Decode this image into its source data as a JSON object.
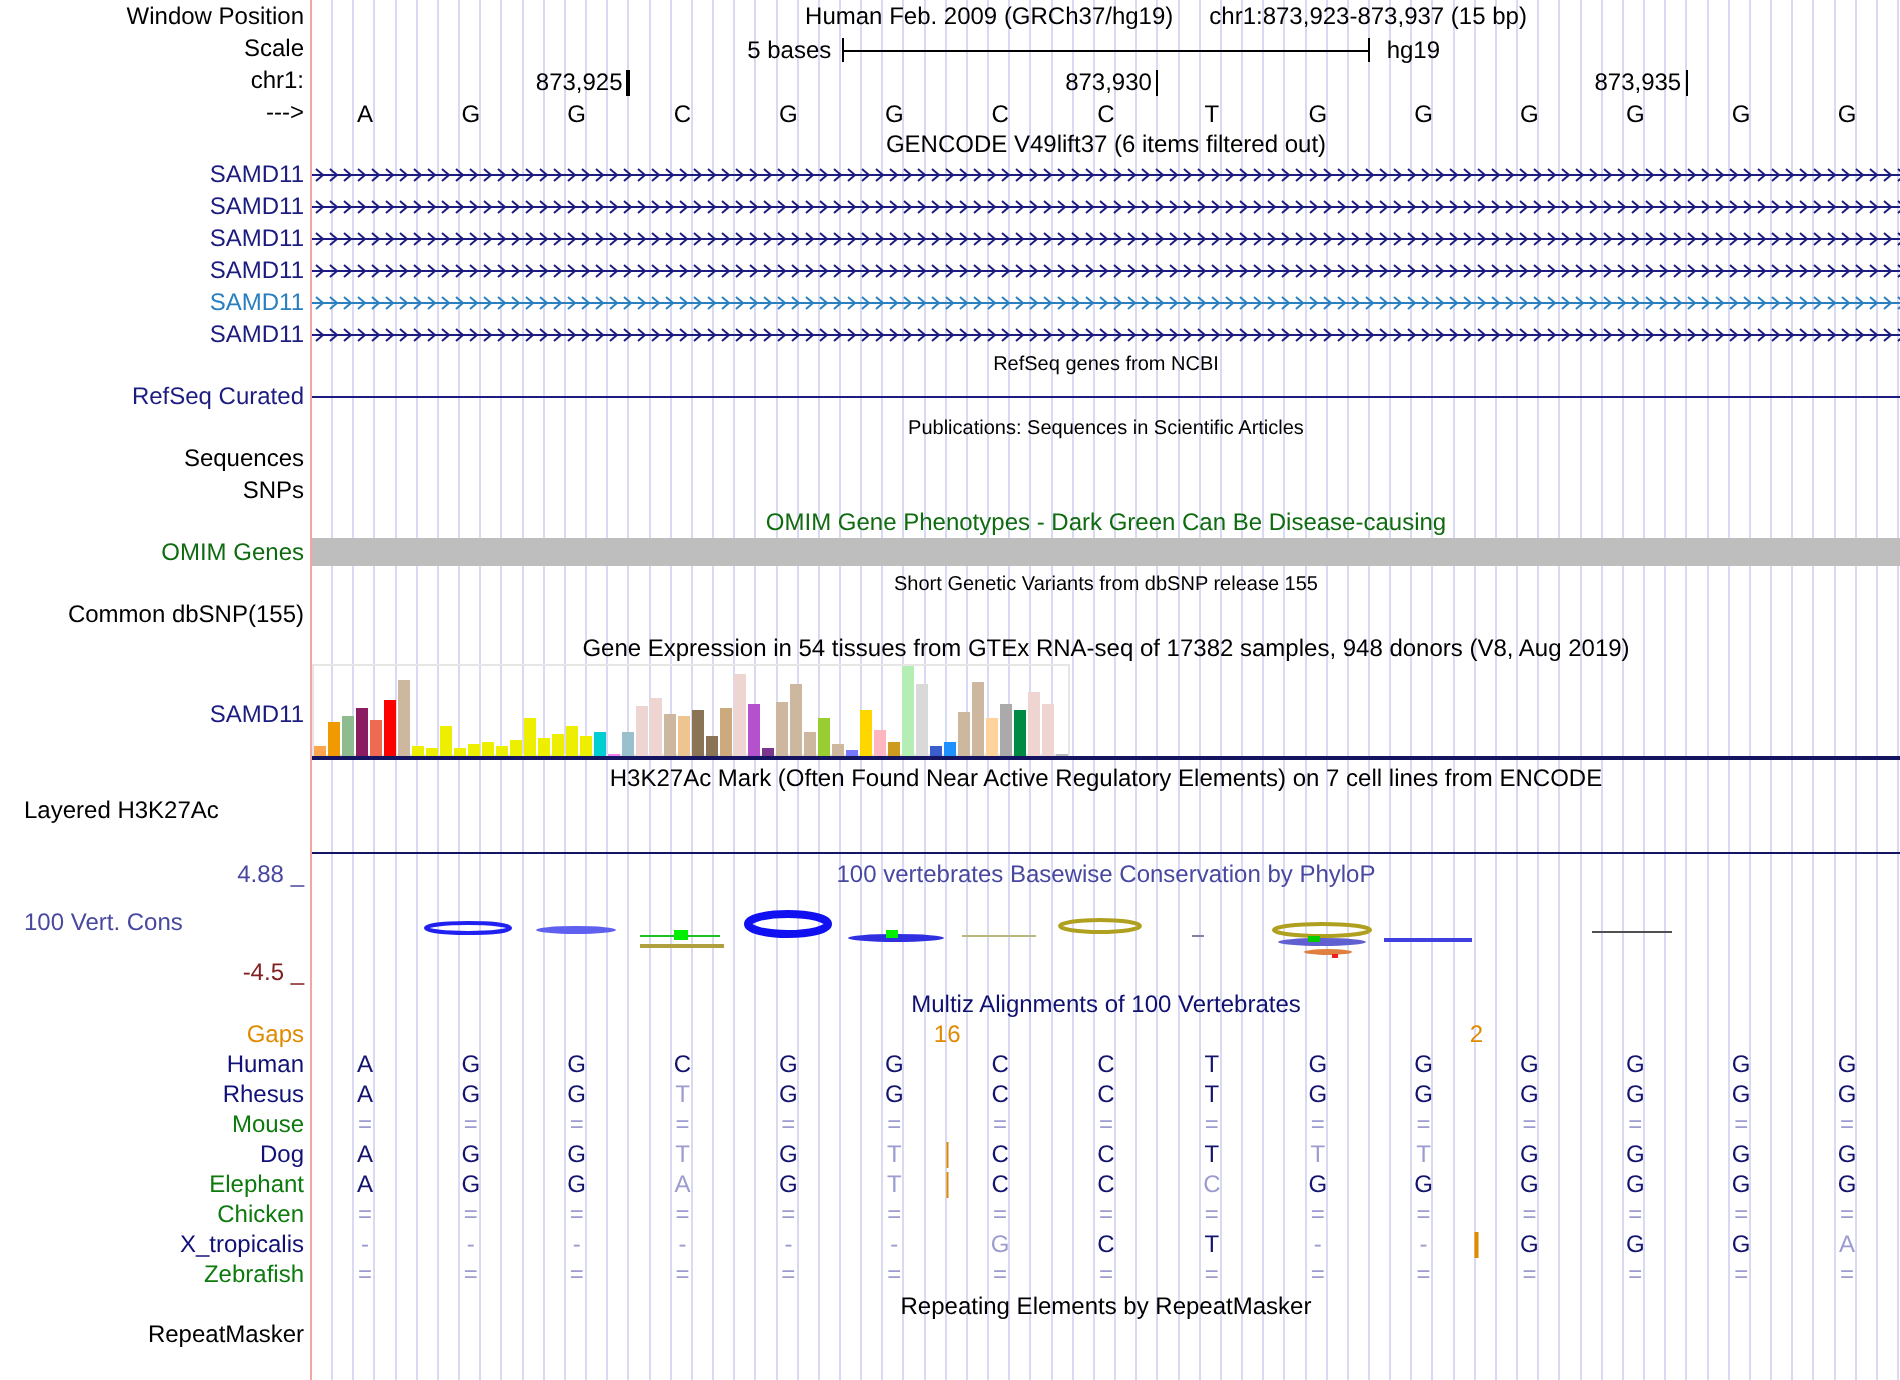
{
  "header": {
    "label": "Window Position",
    "assembly_title": "Human Feb. 2009 (GRCh37/hg19)",
    "position": "chr1:873,923-873,937 (15 bp)"
  },
  "scale": {
    "label": "Scale",
    "bar_label": "5 bases",
    "assembly": "hg19"
  },
  "ruler": {
    "label": "chr1:",
    "ticks": [
      "873,925",
      "873,930",
      "873,935"
    ]
  },
  "bases": {
    "label": "--->",
    "sequence": [
      "A",
      "G",
      "G",
      "C",
      "G",
      "G",
      "C",
      "C",
      "T",
      "G",
      "G",
      "G",
      "G",
      "G",
      "G"
    ]
  },
  "gencode": {
    "title": "GENCODE V49lift37 (6 items filtered out)",
    "transcripts": [
      {
        "label": "SAMD11",
        "color": "#1c1c80"
      },
      {
        "label": "SAMD11",
        "color": "#1c1c80"
      },
      {
        "label": "SAMD11",
        "color": "#1c1c80"
      },
      {
        "label": "SAMD11",
        "color": "#1c1c80"
      },
      {
        "label": "SAMD11",
        "color": "#2a7fc0"
      },
      {
        "label": "SAMD11",
        "color": "#1c1c80"
      }
    ]
  },
  "refseq": {
    "title": "RefSeq genes from NCBI",
    "label": "RefSeq Curated"
  },
  "publications": {
    "title": "Publications: Sequences in Scientific Articles",
    "labels": [
      "Sequences",
      "SNPs"
    ]
  },
  "omim": {
    "title": "OMIM Gene Phenotypes - Dark Green Can Be Disease-causing",
    "label": "OMIM Genes"
  },
  "dbsnp": {
    "title": "Short Genetic Variants from dbSNP release 155",
    "label": "Common dbSNP(155)"
  },
  "gtex": {
    "title": "Gene Expression in 54 tissues from GTEx RNA-seq of 17382 samples, 948 donors (V8, Aug 2019)",
    "label": "SAMD11"
  },
  "h3k27ac": {
    "title": "H3K27Ac Mark (Often Found Near Active Regulatory Elements) on 7 cell lines from ENCODE",
    "label": "Layered H3K27Ac"
  },
  "phylop": {
    "title": "100 vertebrates Basewise Conservation by PhyloP",
    "label": "100 Vert. Cons",
    "max": "4.88 _",
    "min": "-4.5 _"
  },
  "multiz": {
    "title": "Multiz Alignments of 100 Vertebrates",
    "gaps": {
      "label": "Gaps",
      "columns": [
        {
          "insert": false
        },
        {
          "insert": false
        },
        {
          "insert": false
        },
        {
          "insert": false
        },
        {
          "insert": false
        },
        {
          "insert": false
        },
        {
          "insert": true,
          "count": "16"
        },
        {
          "insert": false
        },
        {
          "insert": false
        },
        {
          "insert": false
        },
        {
          "insert": false
        },
        {
          "insert": true,
          "count": "2"
        },
        {
          "insert": false
        },
        {
          "insert": false
        },
        {
          "insert": false
        }
      ]
    },
    "species": [
      {
        "name": "Human",
        "color": "#101078",
        "cells": [
          {
            "base": "A",
            "faded": false,
            "insert": false
          },
          {
            "base": "G",
            "faded": false,
            "insert": false
          },
          {
            "base": "G",
            "faded": false,
            "insert": false
          },
          {
            "base": "C",
            "faded": false,
            "insert": false
          },
          {
            "base": "G",
            "faded": false,
            "insert": false
          },
          {
            "base": "G",
            "faded": false,
            "insert": false
          },
          {
            "base": "C",
            "faded": false,
            "insert": false
          },
          {
            "base": "C",
            "faded": false,
            "insert": false
          },
          {
            "base": "T",
            "faded": false,
            "insert": false
          },
          {
            "base": "G",
            "faded": false,
            "insert": false
          },
          {
            "base": "G",
            "faded": false,
            "insert": false
          },
          {
            "base": "G",
            "faded": false,
            "insert": false
          },
          {
            "base": "G",
            "faded": false,
            "insert": false
          },
          {
            "base": "G",
            "faded": false,
            "insert": false
          },
          {
            "base": "G",
            "faded": false,
            "insert": false
          }
        ]
      },
      {
        "name": "Rhesus",
        "color": "#101078",
        "cells": [
          {
            "base": "A",
            "faded": false,
            "insert": false
          },
          {
            "base": "G",
            "faded": false,
            "insert": false
          },
          {
            "base": "G",
            "faded": false,
            "insert": false
          },
          {
            "base": "T",
            "faded": true,
            "insert": false
          },
          {
            "base": "G",
            "faded": false,
            "insert": false
          },
          {
            "base": "G",
            "faded": false,
            "insert": false
          },
          {
            "base": "C",
            "faded": false,
            "insert": false
          },
          {
            "base": "C",
            "faded": false,
            "insert": false
          },
          {
            "base": "T",
            "faded": false,
            "insert": false
          },
          {
            "base": "G",
            "faded": false,
            "insert": false
          },
          {
            "base": "G",
            "faded": false,
            "insert": false
          },
          {
            "base": "G",
            "faded": false,
            "insert": false
          },
          {
            "base": "G",
            "faded": false,
            "insert": false
          },
          {
            "base": "G",
            "faded": false,
            "insert": false
          },
          {
            "base": "G",
            "faded": false,
            "insert": false
          }
        ]
      },
      {
        "name": "Mouse",
        "color": "#0c7a0c",
        "cells": [
          {
            "base": "=",
            "faded": true,
            "insert": false
          },
          {
            "base": "=",
            "faded": true,
            "insert": false
          },
          {
            "base": "=",
            "faded": true,
            "insert": false
          },
          {
            "base": "=",
            "faded": true,
            "insert": false
          },
          {
            "base": "=",
            "faded": true,
            "insert": false
          },
          {
            "base": "=",
            "faded": true,
            "insert": false
          },
          {
            "base": "=",
            "faded": true,
            "insert": false
          },
          {
            "base": "=",
            "faded": true,
            "insert": false
          },
          {
            "base": "=",
            "faded": true,
            "insert": false
          },
          {
            "base": "=",
            "faded": true,
            "insert": false
          },
          {
            "base": "=",
            "faded": true,
            "insert": false
          },
          {
            "base": "=",
            "faded": true,
            "insert": false
          },
          {
            "base": "=",
            "faded": true,
            "insert": false
          },
          {
            "base": "=",
            "faded": true,
            "insert": false
          },
          {
            "base": "=",
            "faded": true,
            "insert": false
          }
        ]
      },
      {
        "name": "Dog",
        "color": "#101078",
        "cells": [
          {
            "base": "A",
            "faded": false,
            "insert": false
          },
          {
            "base": "G",
            "faded": false,
            "insert": false
          },
          {
            "base": "G",
            "faded": false,
            "insert": false
          },
          {
            "base": "T",
            "faded": true,
            "insert": false
          },
          {
            "base": "G",
            "faded": false,
            "insert": false
          },
          {
            "base": "T",
            "faded": true,
            "insert": false
          },
          {
            "base": "C",
            "faded": false,
            "insert": true
          },
          {
            "base": "C",
            "faded": false,
            "insert": false
          },
          {
            "base": "T",
            "faded": false,
            "insert": false
          },
          {
            "base": "T",
            "faded": true,
            "insert": false
          },
          {
            "base": "T",
            "faded": true,
            "insert": false
          },
          {
            "base": "G",
            "faded": false,
            "insert": false
          },
          {
            "base": "G",
            "faded": false,
            "insert": false
          },
          {
            "base": "G",
            "faded": false,
            "insert": false
          },
          {
            "base": "G",
            "faded": false,
            "insert": false
          }
        ]
      },
      {
        "name": "Elephant",
        "color": "#0c7a0c",
        "cells": [
          {
            "base": "A",
            "faded": false,
            "insert": false
          },
          {
            "base": "G",
            "faded": false,
            "insert": false
          },
          {
            "base": "G",
            "faded": false,
            "insert": false
          },
          {
            "base": "A",
            "faded": true,
            "insert": false
          },
          {
            "base": "G",
            "faded": false,
            "insert": false
          },
          {
            "base": "T",
            "faded": true,
            "insert": false
          },
          {
            "base": "C",
            "faded": false,
            "insert": true
          },
          {
            "base": "C",
            "faded": false,
            "insert": false
          },
          {
            "base": "C",
            "faded": true,
            "insert": false
          },
          {
            "base": "G",
            "faded": false,
            "insert": false
          },
          {
            "base": "G",
            "faded": false,
            "insert": false
          },
          {
            "base": "G",
            "faded": false,
            "insert": false
          },
          {
            "base": "G",
            "faded": false,
            "insert": false
          },
          {
            "base": "G",
            "faded": false,
            "insert": false
          },
          {
            "base": "G",
            "faded": false,
            "insert": false
          }
        ]
      },
      {
        "name": "Chicken",
        "color": "#0c7a0c",
        "cells": [
          {
            "base": "=",
            "faded": true,
            "insert": false
          },
          {
            "base": "=",
            "faded": true,
            "insert": false
          },
          {
            "base": "=",
            "faded": true,
            "insert": false
          },
          {
            "base": "=",
            "faded": true,
            "insert": false
          },
          {
            "base": "=",
            "faded": true,
            "insert": false
          },
          {
            "base": "=",
            "faded": true,
            "insert": false
          },
          {
            "base": "=",
            "faded": true,
            "insert": false
          },
          {
            "base": "=",
            "faded": true,
            "insert": false
          },
          {
            "base": "=",
            "faded": true,
            "insert": false
          },
          {
            "base": "=",
            "faded": true,
            "insert": false
          },
          {
            "base": "=",
            "faded": true,
            "insert": false
          },
          {
            "base": "=",
            "faded": true,
            "insert": false
          },
          {
            "base": "=",
            "faded": true,
            "insert": false
          },
          {
            "base": "=",
            "faded": true,
            "insert": false
          },
          {
            "base": "=",
            "faded": true,
            "insert": false
          }
        ]
      },
      {
        "name": "X_tropicalis",
        "color": "#101078",
        "cells": [
          {
            "base": "-",
            "faded": true,
            "insert": false
          },
          {
            "base": "-",
            "faded": true,
            "insert": false
          },
          {
            "base": "-",
            "faded": true,
            "insert": false
          },
          {
            "base": "-",
            "faded": true,
            "insert": false
          },
          {
            "base": "-",
            "faded": true,
            "insert": false
          },
          {
            "base": "-",
            "faded": true,
            "insert": false
          },
          {
            "base": "G",
            "faded": true,
            "insert": false
          },
          {
            "base": "C",
            "faded": false,
            "insert": false
          },
          {
            "base": "T",
            "faded": false,
            "insert": false
          },
          {
            "base": "-",
            "faded": true,
            "insert": false
          },
          {
            "base": "-",
            "faded": true,
            "insert": false
          },
          {
            "base": "G",
            "faded": false,
            "insert": true
          },
          {
            "base": "G",
            "faded": false,
            "insert": false
          },
          {
            "base": "G",
            "faded": false,
            "insert": false
          },
          {
            "base": "A",
            "faded": true,
            "insert": false
          }
        ]
      },
      {
        "name": "Zebrafish",
        "color": "#0c7a0c",
        "cells": [
          {
            "base": "=",
            "faded": true,
            "insert": false
          },
          {
            "base": "=",
            "faded": true,
            "insert": false
          },
          {
            "base": "=",
            "faded": true,
            "insert": false
          },
          {
            "base": "=",
            "faded": true,
            "insert": false
          },
          {
            "base": "=",
            "faded": true,
            "insert": false
          },
          {
            "base": "=",
            "faded": true,
            "insert": false
          },
          {
            "base": "=",
            "faded": true,
            "insert": false
          },
          {
            "base": "=",
            "faded": true,
            "insert": false
          },
          {
            "base": "=",
            "faded": true,
            "insert": false
          },
          {
            "base": "=",
            "faded": true,
            "insert": false
          },
          {
            "base": "=",
            "faded": true,
            "insert": false
          },
          {
            "base": "=",
            "faded": true,
            "insert": false
          },
          {
            "base": "=",
            "faded": true,
            "insert": false
          },
          {
            "base": "=",
            "faded": true,
            "insert": false
          },
          {
            "base": "=",
            "faded": true,
            "insert": false
          }
        ]
      }
    ]
  },
  "repeatmasker": {
    "title": "Repeating Elements by RepeatMasker",
    "label": "RepeatMasker"
  }
}
